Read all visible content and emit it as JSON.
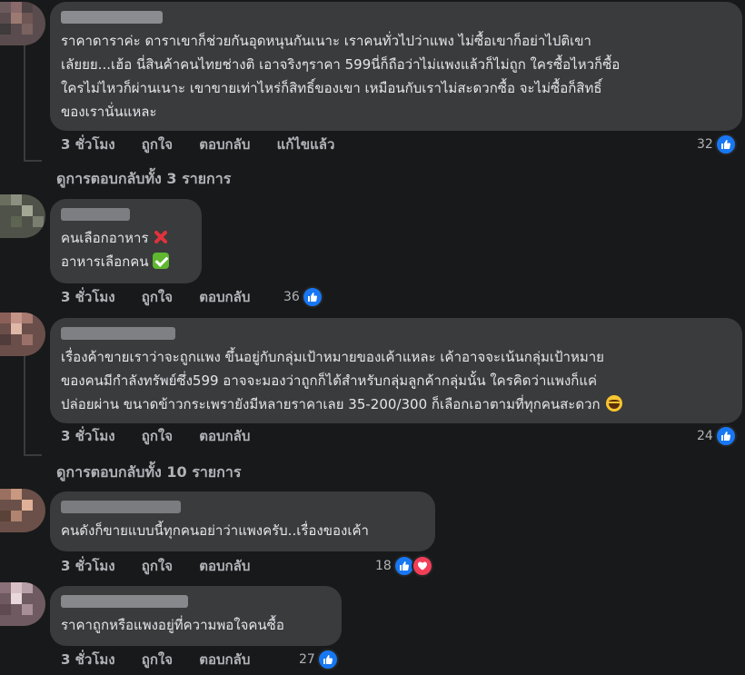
{
  "colors": {
    "background": "#18191a",
    "bubble": "#3a3b3c",
    "text": "#e4e6eb",
    "secondary_text": "#b0b3b8",
    "like_blue": "#1877f2",
    "love_red": "#f33e58"
  },
  "comments": [
    {
      "lines": [
        "ราคาดาราค่ะ ดาราเขาก็ช่วยกันอุดหนุนกันเนาะ เราคนทั่วไปว่าแพง ไม่ซื้อเขาก็อย่าไปติเขา",
        "เลัยยย...เฮ้อ นี่สินค้าคนไทยช่างติ เอาจริงๆราคา 599นี่ก็ถือว่าไม่แพงแล้วก็ไม่ถูก ใครซื้อไหวก็ซื้อ",
        "ใครไม่ไหวก็ผ่านเนาะ เขาขายเท่าไหร่ก็สิทธิ์ของเขา เหมือนกับเราไม่สะดวกซื้อ จะไม่ซื้อก็สิทธิ์",
        "ของเรานั่นแหละ"
      ],
      "time": "3 ชั่วโมง",
      "like": "ถูกใจ",
      "reply": "ตอบกลับ",
      "edited": "แก้ไขแล้ว",
      "reaction_count": "32",
      "reaction_icons": [
        "like-icon"
      ]
    },
    {
      "lines": [
        "คนเลือกอาหาร",
        "อาหารเลือกคน"
      ],
      "emojis": [
        "cross-mark-emoji",
        "check-mark-emoji"
      ],
      "time": "3 ชั่วโมง",
      "like": "ถูกใจ",
      "reply": "ตอบกลับ",
      "reaction_count": "36",
      "reaction_icons": [
        "like-icon"
      ]
    },
    {
      "lines": [
        "เรื่องค้าขายเราว่าจะถูกแพง ขึ้นอยู่กับกลุ่มเป้าหมายของเค้าแหละ เค้าอาจจะเน้นกลุ่มเป้าหมาย",
        "ของคนมีกำลังทรัพย์ซึ่ง599 อาจจะมองว่าถูกก็ได้สำหรับกลุ่มลูกค้ากลุ่มนั้น ใครคิดว่าแพงก็แค่",
        "ปล่อยผ่าน ขนาดข้าวกระเพรายังมีหลายราคาเลย 35-200/300 ก็เลือกเอาตามที่ทุกคนสะดวก"
      ],
      "emojis": [
        "laughing-emoji"
      ],
      "time": "3 ชั่วโมง",
      "like": "ถูกใจ",
      "reply": "ตอบกลับ",
      "reaction_count": "24",
      "reaction_icons": [
        "like-icon"
      ]
    },
    {
      "lines": [
        "คนดังก็ขายแบบนี้ทุกคนอย่าว่าแพงครับ..เรื่องของเค้า"
      ],
      "time": "3 ชั่วโมง",
      "like": "ถูกใจ",
      "reply": "ตอบกลับ",
      "reaction_count": "18",
      "reaction_icons": [
        "like-icon",
        "love-icon"
      ]
    },
    {
      "lines": [
        "ราคาถูกหรือแพงอยู่ที่ความพอใจคนซื้อ"
      ],
      "time": "3 ชั่วโมง",
      "like": "ถูกใจ",
      "reply": "ตอบกลับ",
      "reaction_count": "27",
      "reaction_icons": [
        "like-icon"
      ]
    }
  ],
  "view_replies": [
    "ดูการตอบกลับทั้ง 3 รายการ",
    "ดูการตอบกลับทั้ง 10 รายการ"
  ]
}
